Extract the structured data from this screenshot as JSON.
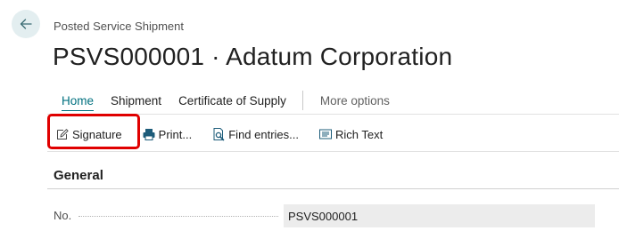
{
  "header": {
    "caption": "Posted Service Shipment",
    "title": "PSVS000001 · Adatum Corporation"
  },
  "tabs": [
    {
      "label": "Home",
      "active": true
    },
    {
      "label": "Shipment"
    },
    {
      "label": "Certificate of Supply"
    },
    {
      "label": "More options"
    }
  ],
  "actions": [
    {
      "label": "Signature",
      "icon": "signature-icon"
    },
    {
      "label": "Print...",
      "icon": "printer-icon"
    },
    {
      "label": "Find entries...",
      "icon": "find-entries-icon"
    },
    {
      "label": "Rich Text",
      "icon": "rich-text-icon"
    }
  ],
  "general": {
    "section_title": "General",
    "fields": [
      {
        "label": "No.",
        "value": "PSVS000001"
      }
    ]
  },
  "colors": {
    "accent": "#00707f",
    "highlight": "#e00000",
    "back_button_bg": "#e3eef0"
  }
}
